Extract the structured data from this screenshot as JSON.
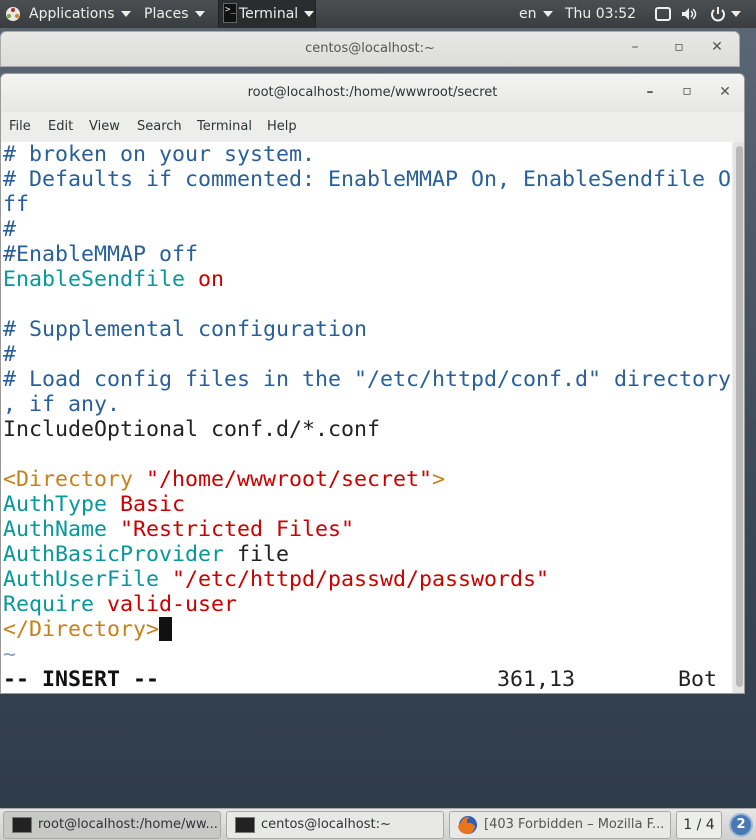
{
  "top_panel": {
    "applications": "Applications",
    "places": "Places",
    "terminal": "Terminal",
    "language": "en",
    "clock": "Thu 03:52"
  },
  "bg_window": {
    "title": "centos@localhost:~"
  },
  "main_window": {
    "title": "root@localhost:/home/wwwroot/secret",
    "menu": [
      "File",
      "Edit",
      "View",
      "Search",
      "Terminal",
      "Help"
    ]
  },
  "editor": {
    "lines": {
      "l0": "# broken on your system.",
      "l1": "# Defaults if commented: EnableMMAP On, EnableSendfile O",
      "l2": "ff",
      "l3": "#",
      "l4": "#EnableMMAP off",
      "l5_kw": "EnableSendfile",
      "l5_val": "on",
      "l7": "# Supplemental configuration",
      "l8": "#",
      "l9": "# Load config files in the \"/etc/httpd/conf.d\" directory",
      "l10": ", if any.",
      "l11": "IncludeOptional conf.d/*.conf",
      "l13_open": "<Directory ",
      "l13_path": "\"/home/wwwroot/secret\"",
      "l13_close": ">",
      "l14_kw": "AuthType",
      "l14_val": "Basic",
      "l15_kw": "AuthName",
      "l15_val": "\"Restricted Files\"",
      "l16_kw": "AuthBasicProvider",
      "l16_val": "file",
      "l17_kw": "AuthUserFile",
      "l17_val": "\"/etc/httpd/passwd/passwords\"",
      "l18_kw": "Require",
      "l18_val": "valid-user",
      "l19": "</Directory>",
      "tilde": "~"
    },
    "status": {
      "mode": "-- INSERT --",
      "position": "361,13",
      "scroll": "Bot"
    }
  },
  "taskbar": {
    "tasks": [
      {
        "label": "root@localhost:/home/ww..."
      },
      {
        "label": "centos@localhost:~"
      },
      {
        "label": "[403 Forbidden – Mozilla F..."
      }
    ],
    "workspace": "1 / 4",
    "notifications": "2"
  }
}
